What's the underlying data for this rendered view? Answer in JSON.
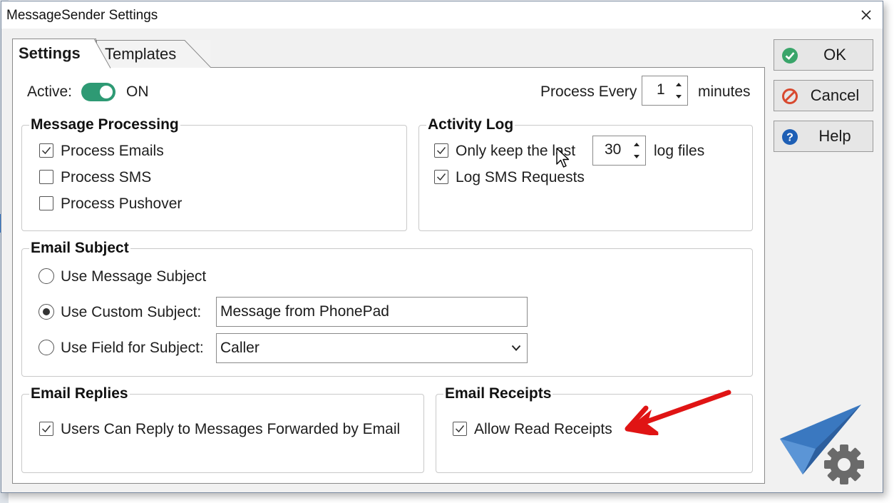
{
  "window": {
    "title": "MessageSender Settings"
  },
  "tabs": [
    {
      "label": "Settings"
    },
    {
      "label": "Templates"
    }
  ],
  "active": {
    "label": "Active:",
    "state": "ON"
  },
  "process_every": {
    "label": "Process Every",
    "value": "1",
    "unit": "minutes"
  },
  "message_processing": {
    "title": "Message Processing",
    "items": [
      {
        "label": "Process Emails",
        "checked": true
      },
      {
        "label": "Process SMS",
        "checked": false
      },
      {
        "label": "Process Pushover",
        "checked": false
      }
    ]
  },
  "activity_log": {
    "title": "Activity Log",
    "keep_label": "Only keep the last",
    "keep_value": "30",
    "keep_unit": "log files",
    "log_sms_label": "Log SMS Requests"
  },
  "email_subject": {
    "title": "Email Subject",
    "options": [
      {
        "label": "Use Message Subject",
        "selected": false
      },
      {
        "label": "Use Custom Subject:",
        "selected": true
      },
      {
        "label": "Use Field for Subject:",
        "selected": false
      }
    ],
    "custom_subject": "Message from PhonePad",
    "field_subject": "Caller"
  },
  "email_replies": {
    "title": "Email Replies",
    "label": "Users Can Reply to Messages Forwarded by Email"
  },
  "email_receipts": {
    "title": "Email Receipts",
    "label": "Allow Read Receipts"
  },
  "buttons": {
    "ok": "OK",
    "cancel": "Cancel",
    "help": "Help"
  },
  "colors": {
    "accent": "#2e9a74",
    "ok_icon": "#3aa56a",
    "cancel_icon": "#d8492f",
    "help_icon": "#1e5fb5",
    "annotation_arrow": "#e01414",
    "brand_blue": "#3a78c0"
  }
}
